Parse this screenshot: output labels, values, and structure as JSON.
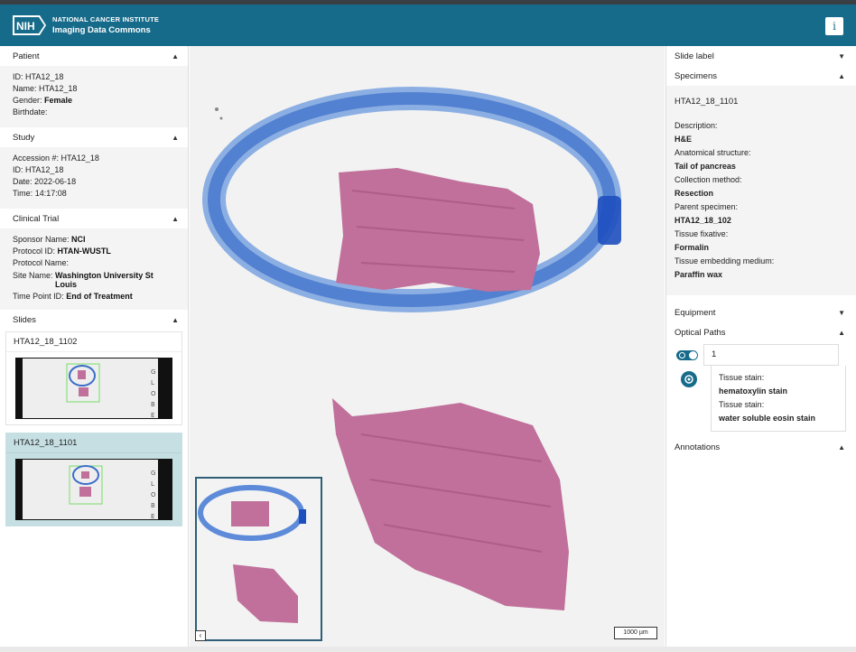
{
  "header": {
    "org": "NATIONAL CANCER INSTITUTE",
    "product": "Imaging Data Commons",
    "logo_text": "NIH",
    "info_label": "i"
  },
  "left": {
    "patient": {
      "title": "Patient",
      "rows": [
        {
          "label": "ID",
          "value": "HTA12_18",
          "bold": false
        },
        {
          "label": "Name",
          "value": "HTA12_18",
          "bold": false
        },
        {
          "label": "Gender",
          "value": "Female",
          "bold": true
        },
        {
          "label": "Birthdate",
          "value": "",
          "bold": false
        }
      ]
    },
    "study": {
      "title": "Study",
      "rows": [
        {
          "label": "Accession #",
          "value": "HTA12_18"
        },
        {
          "label": "ID",
          "value": "HTA12_18"
        },
        {
          "label": "Date",
          "value": "2022-06-18"
        },
        {
          "label": "Time",
          "value": "14:17:08"
        }
      ]
    },
    "trial": {
      "title": "Clinical Trial",
      "rows": [
        {
          "label": "Sponsor Name",
          "value": "NCI"
        },
        {
          "label": "Protocol ID",
          "value": "HTAN-WUSTL"
        },
        {
          "label": "Protocol Name",
          "value": ""
        },
        {
          "label": "Site Name",
          "value": "Washington University St Louis"
        },
        {
          "label": "Time Point ID",
          "value": "End of Treatment"
        }
      ]
    },
    "slides": {
      "title": "Slides",
      "items": [
        {
          "label": "HTA12_18_1102",
          "selected": false
        },
        {
          "label": "HTA12_18_1101",
          "selected": true
        }
      ]
    }
  },
  "viewer": {
    "scale_label": "1000 µm",
    "overview_toggle": "‹"
  },
  "right": {
    "slide_label": "Slide label",
    "specimens": {
      "title": "Specimens",
      "id": "HTA12_18_1101",
      "rows": [
        {
          "label": "Description",
          "value": "H&E"
        },
        {
          "label": "Anatomical structure",
          "value": "Tail of pancreas"
        },
        {
          "label": "Collection method",
          "value": "Resection"
        },
        {
          "label": "Parent specimen",
          "value": "HTA12_18_102"
        },
        {
          "label": "Tissue fixative",
          "value": "Formalin"
        },
        {
          "label": "Tissue embedding medium",
          "value": "Paraffin wax"
        }
      ]
    },
    "equipment": "Equipment",
    "optical_paths": {
      "title": "Optical Paths",
      "path_id": "1",
      "stains": [
        {
          "label": "Tissue stain",
          "value": "hematoxylin stain"
        },
        {
          "label": "Tissue stain",
          "value": "water soluble eosin stain"
        }
      ]
    },
    "annotations": "Annotations"
  },
  "colors": {
    "header": "#176b8a",
    "selected_slide": "#c6dfe2",
    "tissue": "#c0709a",
    "marker": "#3b6ec9"
  }
}
